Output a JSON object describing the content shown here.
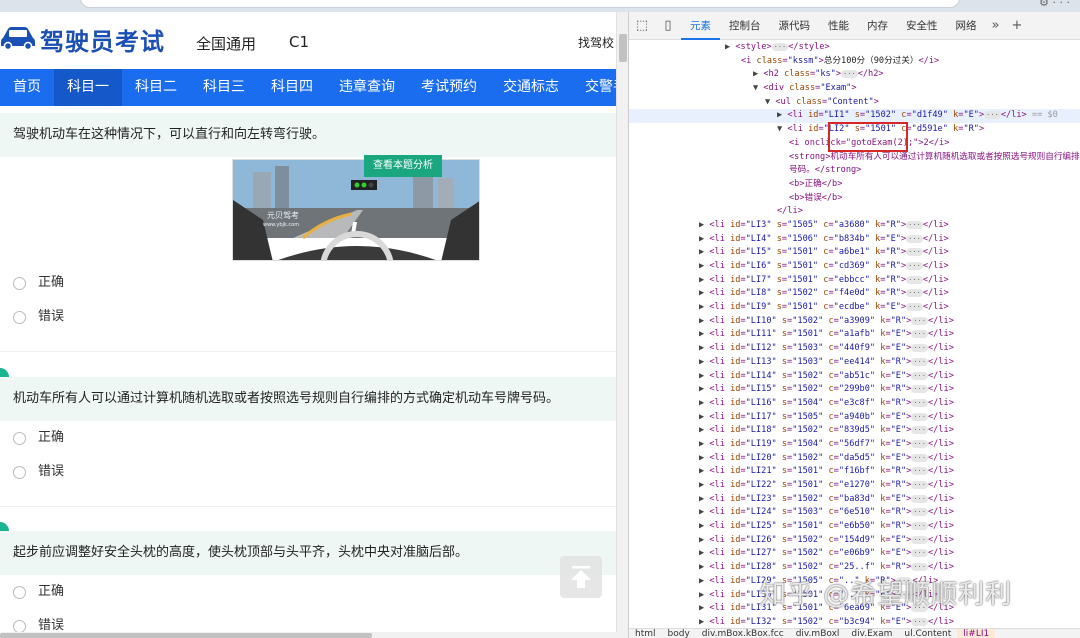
{
  "header": {
    "site_title": "驾驶员考试",
    "region": "全国通用",
    "license": "C1",
    "school": "找驾校"
  },
  "nav": [
    "首页",
    "科目一",
    "科目二",
    "科目三",
    "科目四",
    "违章查询",
    "考试预约",
    "交通标志",
    "交警手"
  ],
  "questions": [
    {
      "text": "驾驶机动车在这种情况下，可以直行和向左转弯行驶。",
      "options": [
        "正确",
        "错误"
      ]
    },
    {
      "text": "机动车所有人可以通过计算机随机选取或者按照选号规则自行编排的方式确定机动车号牌号码。",
      "options": [
        "正确",
        "错误"
      ]
    },
    {
      "text": "起步前应调整好安全头枕的高度，使头枕顶部与头平齐，头枕中央对准脑后部。",
      "options": [
        "正确",
        "错误"
      ]
    }
  ],
  "analysis_button": "查看本题分析",
  "image_watermark": "元贝驾考",
  "image_watermark_url": "www.ybjk.com",
  "devtools": {
    "tabs": [
      "元素",
      "控制台",
      "源代码",
      "性能",
      "内存",
      "安全性",
      "网络"
    ],
    "active_tab": "元素",
    "pre_lines": [
      {
        "tag": "style",
        "text": "",
        "closing": true,
        "collapsed": true
      },
      {
        "tag": "i",
        "attrs": [
          [
            "class",
            "kssm"
          ]
        ],
        "text": "总分100分（90分过关）",
        "inline_close": true
      },
      {
        "tag": "h2",
        "attrs": [
          [
            "class",
            "ks"
          ]
        ],
        "collapsed": true,
        "closing": true
      },
      {
        "tag": "div",
        "attrs": [
          [
            "class",
            "Exam"
          ]
        ],
        "open": true
      },
      {
        "tag": "ul",
        "attrs": [
          [
            "class",
            "Content"
          ]
        ],
        "open": true
      },
      {
        "tag": "li",
        "attrs": [
          [
            "id",
            "LI1"
          ],
          [
            "s",
            "1502"
          ],
          [
            "c",
            "d1f49"
          ],
          [
            "k",
            "E"
          ]
        ],
        "collapsed": true,
        "closing": true,
        "selected": true,
        "suffix": "== $0"
      },
      {
        "tag": "li",
        "attrs": [
          [
            "id",
            "LI2"
          ],
          [
            "s",
            "1501"
          ],
          [
            "c",
            "d591e"
          ],
          [
            "k",
            "R"
          ]
        ],
        "open": true
      },
      {
        "raw": "<i onclick=\"gotoExam(2);\">2</i>"
      },
      {
        "raw": "<strong>机动车所有人可以通过计算机随机选取或者按照选号规则自行编排的"
      },
      {
        "raw": "号码。</strong>"
      },
      {
        "raw": "<b>正确</b>"
      },
      {
        "raw": "<b>错误</b>"
      },
      {
        "raw": "</li>"
      }
    ],
    "li_rows": [
      [
        "LI3",
        "1505",
        "a3680",
        "R"
      ],
      [
        "LI4",
        "1506",
        "b834b",
        "E"
      ],
      [
        "LI5",
        "1501",
        "a6be1",
        "R"
      ],
      [
        "LI6",
        "1501",
        "cd369",
        "R"
      ],
      [
        "LI7",
        "1501",
        "ebbcc",
        "R"
      ],
      [
        "LI8",
        "1502",
        "f4e0d",
        "R"
      ],
      [
        "LI9",
        "1501",
        "ecdbe",
        "E"
      ],
      [
        "LI10",
        "1502",
        "a3909",
        "R"
      ],
      [
        "LI11",
        "1501",
        "a1afb",
        "E"
      ],
      [
        "LI12",
        "1503",
        "440f9",
        "E"
      ],
      [
        "LI13",
        "1503",
        "ee414",
        "R"
      ],
      [
        "LI14",
        "1502",
        "ab51c",
        "E"
      ],
      [
        "LI15",
        "1502",
        "299b0",
        "R"
      ],
      [
        "LI16",
        "1504",
        "e3c8f",
        "R"
      ],
      [
        "LI17",
        "1505",
        "a940b",
        "E"
      ],
      [
        "LI18",
        "1502",
        "839d5",
        "E"
      ],
      [
        "LI19",
        "1504",
        "56df7",
        "E"
      ],
      [
        "LI20",
        "1502",
        "da5d5",
        "E"
      ],
      [
        "LI21",
        "1501",
        "f16bf",
        "R"
      ],
      [
        "LI22",
        "1501",
        "e1270",
        "R"
      ],
      [
        "LI23",
        "1502",
        "ba83d",
        "E"
      ],
      [
        "LI24",
        "1503",
        "6e510",
        "R"
      ],
      [
        "LI25",
        "1501",
        "e6b50",
        "R"
      ],
      [
        "LI26",
        "1502",
        "154d9",
        "E"
      ],
      [
        "LI27",
        "1502",
        "e06b9",
        "E"
      ],
      [
        "LI28",
        "1502",
        "25..f",
        "R"
      ],
      [
        "LI29",
        "1505",
        "..",
        "R"
      ],
      [
        "LI30",
        "1501",
        "..",
        "E"
      ],
      [
        "LI31",
        "1501",
        "6ea69",
        "E"
      ],
      [
        "LI32",
        "1502",
        "b3c94",
        "E"
      ]
    ],
    "breadcrumb": [
      "html",
      "body",
      "div.mBox.kBox.fcc",
      "div.mBoxl",
      "div.Exam",
      "ul.Content",
      "li#LI1"
    ]
  },
  "watermark": "知乎 @希望顺顺利利",
  "colors": {
    "nav": "#1b6df0",
    "nav_active": "#1558c9",
    "accent": "#19b592",
    "logo": "#1a4fb4",
    "highlight": "#d62828"
  }
}
